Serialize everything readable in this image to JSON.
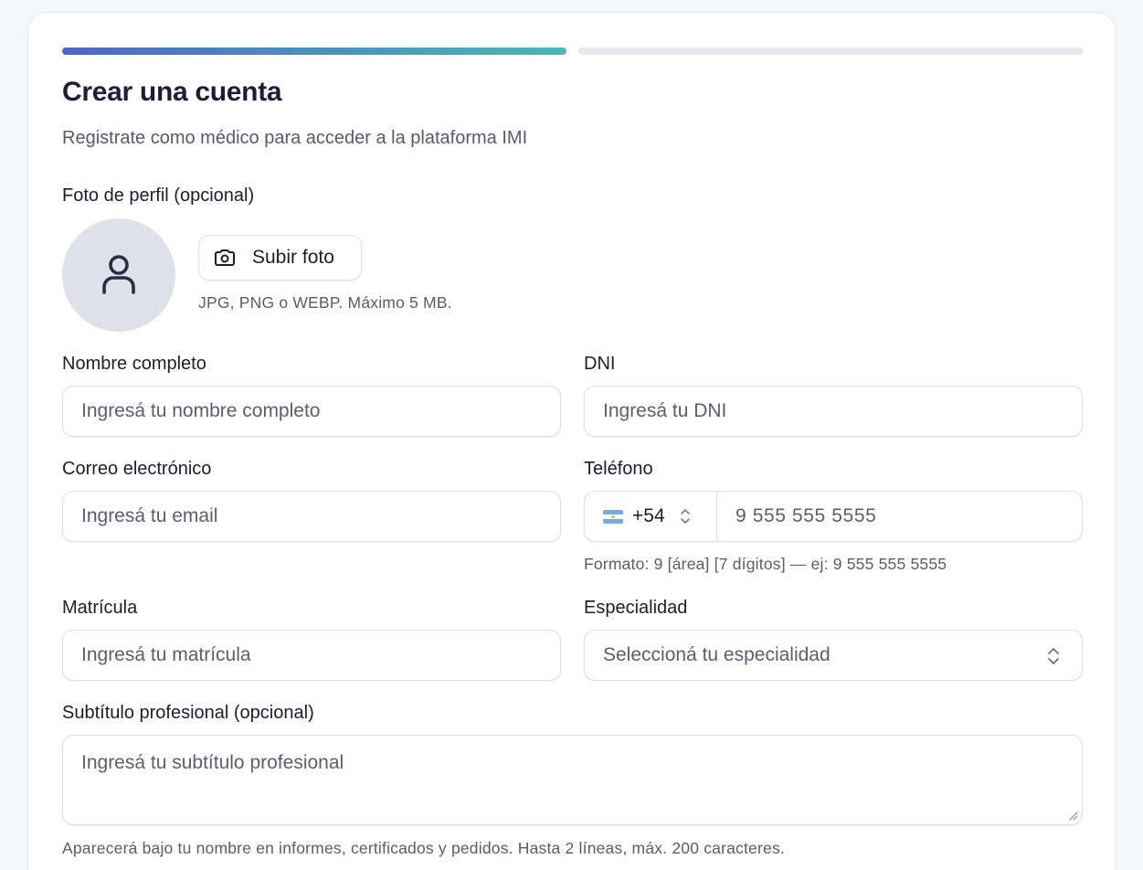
{
  "progress": {
    "current_step": 1,
    "total_steps": 2
  },
  "header": {
    "title": "Crear una cuenta",
    "subtitle": "Registrate como médico para acceder a la plataforma IMI"
  },
  "photo": {
    "label": "Foto de perfil (opcional)",
    "upload_label": "Subir foto",
    "hint": "JPG, PNG o WEBP. Máximo 5 MB.",
    "avatar_icon": "user-icon",
    "upload_icon": "camera-icon"
  },
  "fields": {
    "name": {
      "label": "Nombre completo",
      "placeholder": "Ingresá tu nombre completo"
    },
    "dni": {
      "label": "DNI",
      "placeholder": "Ingresá tu DNI"
    },
    "email": {
      "label": "Correo electrónico",
      "placeholder": "Ingresá tu email"
    },
    "phone": {
      "label": "Teléfono",
      "country_code": "+54",
      "country_flag": "argentina-flag-icon",
      "placeholder": "9 555 555 5555",
      "hint": "Formato: 9 [área] [7 dígitos] — ej: 9 555 555 5555"
    },
    "license": {
      "label": "Matrícula",
      "placeholder": "Ingresá tu matrícula"
    },
    "specialty": {
      "label": "Especialidad",
      "placeholder": "Seleccioná tu especialidad"
    },
    "subtitle": {
      "label": "Subtítulo profesional (opcional)",
      "placeholder": "Ingresá tu subtítulo profesional",
      "hint": "Aparecerá bajo tu nombre en informes, certificados y pedidos. Hasta 2 líneas, máx. 200 caracteres."
    }
  },
  "colors": {
    "progress_start": "#4f66c7",
    "progress_end": "#49b8b4",
    "progress_inactive": "#e8e9ef",
    "title": "#1f1c3b",
    "avatar_bg": "#e0e0eb"
  }
}
